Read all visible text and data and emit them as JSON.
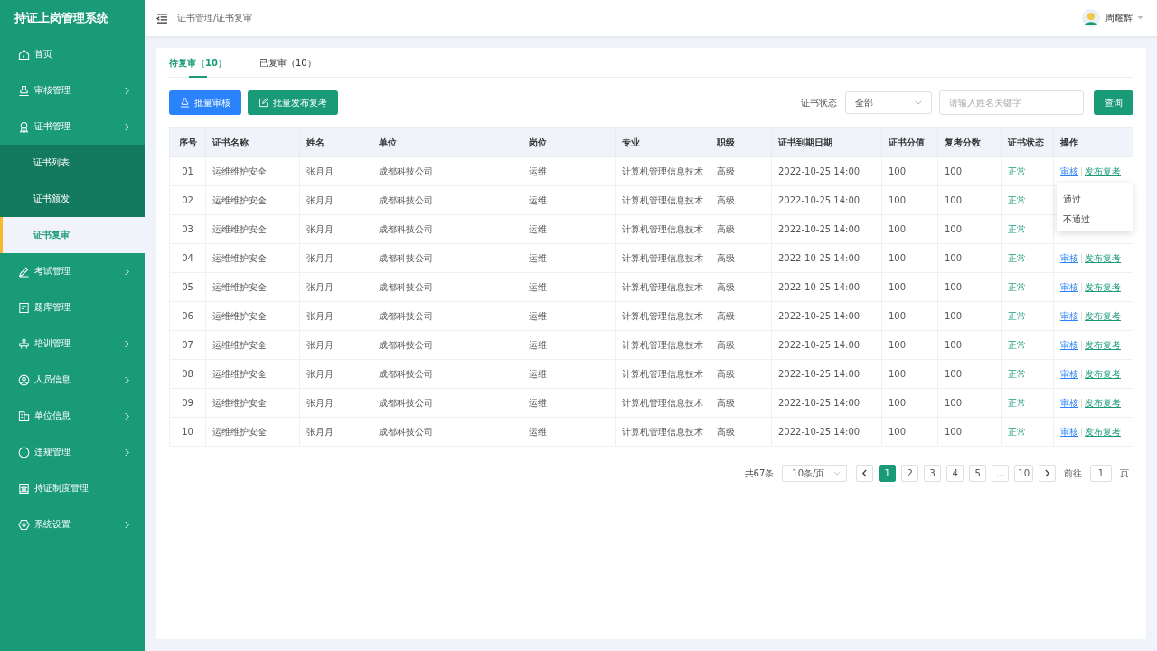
{
  "app": {
    "title": "持证上岗管理系统"
  },
  "sidebar": {
    "items": [
      {
        "label": "首页",
        "expandable": false,
        "selected": false
      },
      {
        "label": "审核管理",
        "expandable": true,
        "selected": false
      },
      {
        "label": "证书管理",
        "expandable": true,
        "selected": false,
        "children": [
          {
            "label": "证书列表",
            "selected": false
          },
          {
            "label": "证书颁发",
            "selected": false
          },
          {
            "label": "证书复审",
            "selected": true
          }
        ]
      },
      {
        "label": "考试管理",
        "expandable": true,
        "selected": false
      },
      {
        "label": "题库管理",
        "expandable": false,
        "selected": false
      },
      {
        "label": "培训管理",
        "expandable": true,
        "selected": false
      },
      {
        "label": "人员信息",
        "expandable": true,
        "selected": false
      },
      {
        "label": "单位信息",
        "expandable": true,
        "selected": false
      },
      {
        "label": "违规管理",
        "expandable": true,
        "selected": false
      },
      {
        "label": "持证制度管理",
        "expandable": false,
        "selected": false
      },
      {
        "label": "系统设置",
        "expandable": true,
        "selected": false
      }
    ]
  },
  "header": {
    "breadcrumb": "证书管理/证书复审",
    "user": "周耀辉"
  },
  "tabs": [
    {
      "label": "待复审（10）",
      "selected": true
    },
    {
      "label": "已复审（10）",
      "selected": false
    }
  ],
  "toolbar": {
    "buttons": [
      {
        "label": "批量审核",
        "kind": "primary"
      },
      {
        "label": "批量发布复考",
        "kind": "success"
      }
    ],
    "filter_label": "证书状态",
    "status_select": "全部",
    "search": {
      "placeholder": "请输入姓名关键字"
    },
    "query_button": "查询"
  },
  "table": {
    "columns": [
      "序号",
      "证书名称",
      "姓名",
      "单位",
      "岗位",
      "专业",
      "职级",
      "证书到期日期",
      "证书分值",
      "复考分数",
      "证书状态",
      "操作"
    ],
    "rows": [
      {
        "cells": [
          "01",
          "运维维护安全",
          "张月月",
          "成都科技公司",
          "运维",
          "计算机管理信息技术",
          "高级",
          "2022-10-25 14:00",
          "100",
          "100"
        ],
        "status": "正常",
        "actions": [
          "审核",
          "发布复考"
        ]
      },
      {
        "cells": [
          "02",
          "运维维护安全",
          "张月月",
          "成都科技公司",
          "运维",
          "计算机管理信息技术",
          "高级",
          "2022-10-25 14:00",
          "100",
          "100"
        ],
        "status": "正常"
      },
      {
        "cells": [
          "03",
          "运维维护安全",
          "张月月",
          "成都科技公司",
          "运维",
          "计算机管理信息技术",
          "高级",
          "2022-10-25 14:00",
          "100",
          "100"
        ],
        "status": "正常"
      },
      {
        "cells": [
          "04",
          "运维维护安全",
          "张月月",
          "成都科技公司",
          "运维",
          "计算机管理信息技术",
          "高级",
          "2022-10-25 14:00",
          "100",
          "100"
        ],
        "status": "正常",
        "actions": [
          "审核",
          "发布复考"
        ]
      },
      {
        "cells": [
          "05",
          "运维维护安全",
          "张月月",
          "成都科技公司",
          "运维",
          "计算机管理信息技术",
          "高级",
          "2022-10-25 14:00",
          "100",
          "100"
        ],
        "status": "正常",
        "actions": [
          "审核",
          "发布复考"
        ]
      },
      {
        "cells": [
          "06",
          "运维维护安全",
          "张月月",
          "成都科技公司",
          "运维",
          "计算机管理信息技术",
          "高级",
          "2022-10-25 14:00",
          "100",
          "100"
        ],
        "status": "正常",
        "actions": [
          "审核",
          "发布复考"
        ]
      },
      {
        "cells": [
          "07",
          "运维维护安全",
          "张月月",
          "成都科技公司",
          "运维",
          "计算机管理信息技术",
          "高级",
          "2022-10-25 14:00",
          "100",
          "100"
        ],
        "status": "正常",
        "actions": [
          "审核",
          "发布复考"
        ]
      },
      {
        "cells": [
          "08",
          "运维维护安全",
          "张月月",
          "成都科技公司",
          "运维",
          "计算机管理信息技术",
          "高级",
          "2022-10-25 14:00",
          "100",
          "100"
        ],
        "status": "正常",
        "actions": [
          "审核",
          "发布复考"
        ]
      },
      {
        "cells": [
          "09",
          "运维维护安全",
          "张月月",
          "成都科技公司",
          "运维",
          "计算机管理信息技术",
          "高级",
          "2022-10-25 14:00",
          "100",
          "100"
        ],
        "status": "正常",
        "actions": [
          "审核",
          "发布复考"
        ]
      },
      {
        "cells": [
          "10",
          "运维维护安全",
          "张月月",
          "成都科技公司",
          "运维",
          "计算机管理信息技术",
          "高级",
          "2022-10-25 14:00",
          "100",
          "100"
        ],
        "status": "正常",
        "actions": [
          "审核",
          "发布复考"
        ]
      }
    ]
  },
  "popover": {
    "items": [
      "通过",
      "不通过"
    ]
  },
  "pagination": {
    "total": "共67条",
    "page_size": "10条/页",
    "pages": [
      {
        "label": "1",
        "selected": true
      },
      {
        "label": "2",
        "selected": false
      },
      {
        "label": "3",
        "selected": false
      },
      {
        "label": "4",
        "selected": false
      },
      {
        "label": "5",
        "selected": false
      },
      {
        "label": "...",
        "selected": false
      },
      {
        "label": "10",
        "selected": false
      }
    ],
    "goto_label": "前往",
    "goto_value": "1",
    "page_unit": "页"
  }
}
